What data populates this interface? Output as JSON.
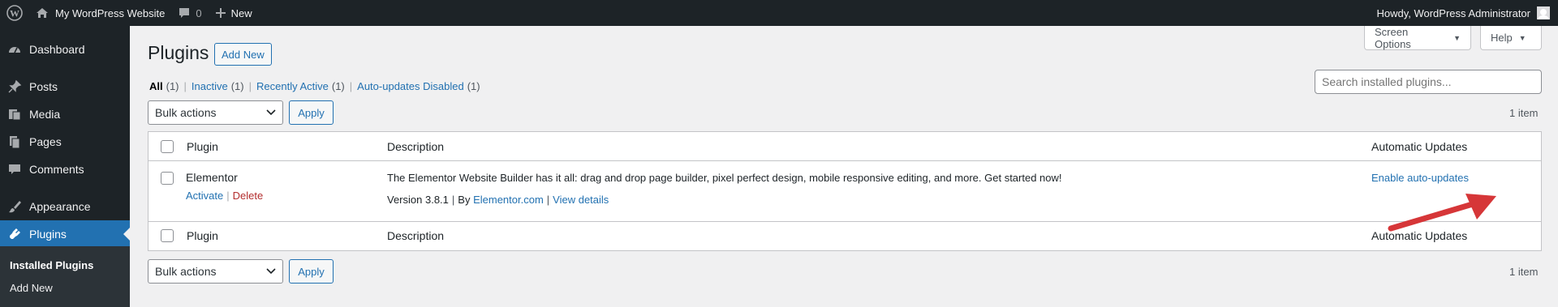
{
  "adminbar": {
    "site_name": "My WordPress Website",
    "comments_count": "0",
    "new_label": "New",
    "howdy": "Howdy, WordPress Administrator"
  },
  "sidebar": {
    "items": [
      {
        "label": "Dashboard",
        "icon": "dashboard-icon"
      },
      {
        "label": "Posts",
        "icon": "pin-icon"
      },
      {
        "label": "Media",
        "icon": "media-icon"
      },
      {
        "label": "Pages",
        "icon": "pages-icon"
      },
      {
        "label": "Comments",
        "icon": "comment-icon"
      },
      {
        "label": "Appearance",
        "icon": "brush-icon"
      },
      {
        "label": "Plugins",
        "icon": "plugin-icon"
      }
    ],
    "submenu": [
      "Installed Plugins",
      "Add New"
    ]
  },
  "header": {
    "screen_options": "Screen Options",
    "help": "Help",
    "title": "Plugins",
    "add_new": "Add New"
  },
  "views": [
    {
      "label": "All",
      "count": "(1)"
    },
    {
      "label": "Inactive",
      "count": "(1)"
    },
    {
      "label": "Recently Active",
      "count": "(1)"
    },
    {
      "label": "Auto-updates Disabled",
      "count": "(1)"
    }
  ],
  "search": {
    "placeholder": "Search installed plugins..."
  },
  "tablenav": {
    "bulk_actions": "Bulk actions",
    "apply": "Apply",
    "items": "1 item"
  },
  "table": {
    "columns": [
      "Plugin",
      "Description",
      "Automatic Updates"
    ],
    "rows": [
      {
        "name": "Elementor",
        "activate": "Activate",
        "delete": "Delete",
        "description": "The Elementor Website Builder has it all: drag and drop page builder, pixel perfect design, mobile responsive editing, and more. Get started now!",
        "version": "Version 3.8.1",
        "by": "By",
        "author": "Elementor.com",
        "view_details": "View details",
        "auto_updates": "Enable auto-updates"
      }
    ]
  },
  "colors": {
    "admin_bar": "#1d2327",
    "accent": "#2271b1",
    "annotation_arrow": "#d63638"
  }
}
